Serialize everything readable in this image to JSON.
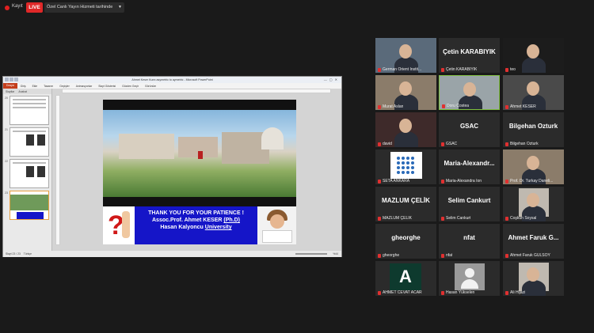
{
  "stream": {
    "rec_label": "Kayıt",
    "live_label": "LIVE",
    "destination": "Özel Canlı Yayın Hizmeti tarihinde"
  },
  "ppt": {
    "window_title": "Ahmet Keser Kunn asymetric to aymetric - Microsoft PowerPoint",
    "ribbon_tabs": [
      "Dosya",
      "Giriş",
      "Ekle",
      "Tasarım",
      "Geçişler",
      "Animasyonlar",
      "Slayt Gösterisi",
      "Gözden Geçir",
      "Görünüm"
    ],
    "thumb_tabs": [
      "Slaytlar",
      "Anahat"
    ],
    "thumb_numbers": [
      "20",
      "21",
      "22",
      "23"
    ],
    "slide": {
      "line1": "THANK YOU FOR YOUR PATIENCE !",
      "line2_pre": "Assoc.Prof. Ahmet KESER ",
      "line2_u": "(Ph.D)",
      "line3_pre": "Hasan Kalyoncu ",
      "line3_u": "University"
    },
    "status_left": "Slayt 23 / 23",
    "status_theme": "Türkçe",
    "zoom": "%44"
  },
  "participants": [
    {
      "name": "German Orient Instit...",
      "big": "",
      "kind": "video"
    },
    {
      "name": "Çetin KARABIYIK",
      "big": "Çetin KARABIYIK",
      "kind": "name"
    },
    {
      "name": "teo",
      "big": "",
      "kind": "video"
    },
    {
      "name": "Murat Aslan",
      "big": "",
      "kind": "video"
    },
    {
      "name": "Doru Costea",
      "big": "",
      "kind": "video"
    },
    {
      "name": "Ahmet KESER",
      "big": "",
      "kind": "video"
    },
    {
      "name": "david",
      "big": "",
      "kind": "video"
    },
    {
      "name": "GSAC",
      "big": "GSAC",
      "kind": "name"
    },
    {
      "name": "Bilgehan Ozturk",
      "big": "Bilgehan Ozturk",
      "kind": "name"
    },
    {
      "name": "SETA ANKARA",
      "big": "",
      "kind": "logo"
    },
    {
      "name": "Maria-Alexandra Ion",
      "big": "Maria-Alexandr...",
      "kind": "name"
    },
    {
      "name": "Prof. Dr. Turkay Daneli...",
      "big": "",
      "kind": "video"
    },
    {
      "name": "MAZLUM ÇELİK",
      "big": "MAZLUM ÇELİK",
      "kind": "name"
    },
    {
      "name": "Selim Cankurt",
      "big": "Selim Cankurt",
      "kind": "name"
    },
    {
      "name": "Coşkun Soysal",
      "big": "",
      "kind": "photo"
    },
    {
      "name": "gheorghe",
      "big": "gheorghe",
      "kind": "name"
    },
    {
      "name": "nfat",
      "big": "nfat",
      "kind": "name"
    },
    {
      "name": "Ahmet Faruk GÜLSOY",
      "big": "Ahmet Faruk G...",
      "kind": "name"
    },
    {
      "name": "AHMET CEVAT ACAR",
      "big": "",
      "kind": "letter",
      "letter": "A"
    },
    {
      "name": "Hasan Yükselen",
      "big": "",
      "kind": "avatar"
    },
    {
      "name": "Ali Hijazi",
      "big": "",
      "kind": "photo"
    }
  ],
  "colors": {
    "live": "#e02828",
    "active_speaker": "#7fbf3f",
    "slide_blue": "#1515c8",
    "mic_muted": "#e03030"
  }
}
